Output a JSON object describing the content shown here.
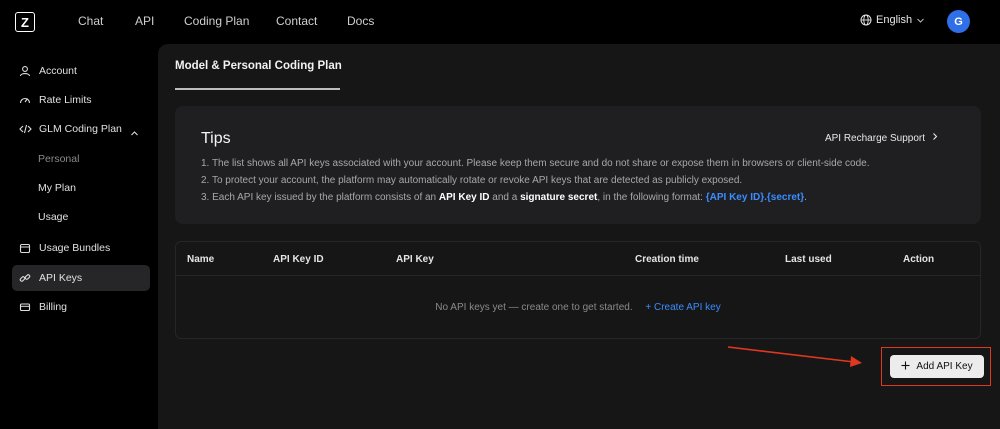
{
  "nav": {
    "logo_letter": "Z",
    "items": [
      "Chat",
      "API",
      "Coding Plan",
      "Contact",
      "Docs"
    ],
    "language": "English",
    "avatar_initial": "G"
  },
  "sidebar": {
    "items": [
      {
        "label": "Account",
        "icon": "user-icon"
      },
      {
        "label": "Rate Limits",
        "icon": "gauge-icon"
      },
      {
        "label": "GLM Coding Plan",
        "icon": "code-icon"
      },
      {
        "label": "Usage Bundles",
        "icon": "calendar-icon"
      },
      {
        "label": "API Keys",
        "icon": "link-icon"
      },
      {
        "label": "Billing",
        "icon": "billing-icon"
      }
    ],
    "sub_items": [
      "Personal",
      "My Plan",
      "Usage"
    ]
  },
  "main": {
    "tab_title": "Model & Personal Coding Plan",
    "tips": {
      "title": "Tips",
      "recharge_link": "API Recharge Support",
      "line1": "1. The list shows all API keys associated with your account. Please keep them secure and do not share or expose them in browsers or client-side code.",
      "line2": "2. To protect your account, the platform may automatically rotate or revoke API keys that are detected as publicly exposed.",
      "line3_a": "3. Each API key issued by the platform consists of an ",
      "line3_b": "API Key ID",
      "line3_c": " and a ",
      "line3_d": "signature secret",
      "line3_e": ", in the following format: ",
      "line3_f": "{API Key ID}.{secret}",
      "line3_g": "."
    },
    "table": {
      "columns": [
        "Name",
        "API Key ID",
        "API Key",
        "Creation time",
        "Last used",
        "Action"
      ],
      "empty_text": "No API keys yet — create one to get started.",
      "create_link": "+ Create API key"
    },
    "add_button": "Add API Key"
  },
  "colors": {
    "accent_blue": "#3b8cff",
    "highlight_red": "#e0371f",
    "avatar_blue": "#2f6fe8"
  }
}
